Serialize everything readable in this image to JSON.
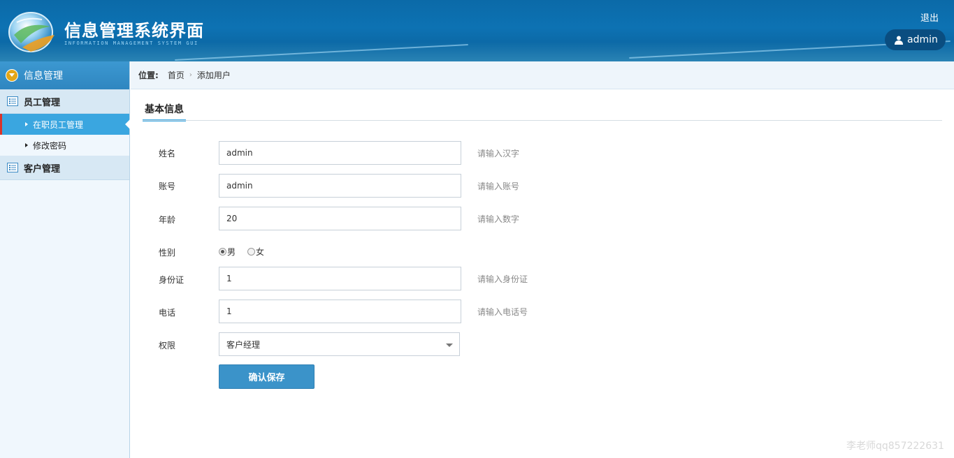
{
  "header": {
    "title_cn": "信息管理系统界面",
    "title_en": "INFORMATION MANAGEMENT SYSTEM GUI",
    "logout_label": "退出",
    "username": "admin",
    "user_icon": "user-icon",
    "logo_icon": "globe-logo-icon"
  },
  "sidebar": {
    "header_label": "信息管理",
    "header_icon": "chevron-down-circle-icon",
    "groups": [
      {
        "label": "员工管理",
        "icon": "list-icon",
        "items": [
          {
            "label": "在职员工管理",
            "active": true
          },
          {
            "label": "修改密码",
            "active": false
          }
        ]
      },
      {
        "label": "客户管理",
        "icon": "list-icon",
        "items": []
      }
    ]
  },
  "breadcrumb": {
    "label": "位置:",
    "items": [
      "首页",
      "添加用户"
    ],
    "separator": "›"
  },
  "form": {
    "section_title": "基本信息",
    "fields": [
      {
        "label": "姓名",
        "value": "admin",
        "hint": "请输入汉字"
      },
      {
        "label": "账号",
        "value": "admin",
        "hint": "请输入账号"
      },
      {
        "label": "年龄",
        "value": "20",
        "hint": "请输入数字"
      },
      {
        "label": "身份证",
        "value": "1",
        "hint": "请输入身份证"
      },
      {
        "label": "电话",
        "value": "1",
        "hint": "请输入电话号"
      }
    ],
    "gender": {
      "label": "性别",
      "options": [
        "男",
        "女"
      ],
      "selected": "男"
    },
    "role": {
      "label": "权限",
      "selected": "客户经理"
    },
    "submit_label": "确认保存"
  },
  "watermark": "李老师qq857222631",
  "colors": {
    "header_bg": "#0d72b3",
    "accent": "#3aa6e0",
    "active_marker": "#d9342b",
    "button_bg": "#3b93c9"
  }
}
